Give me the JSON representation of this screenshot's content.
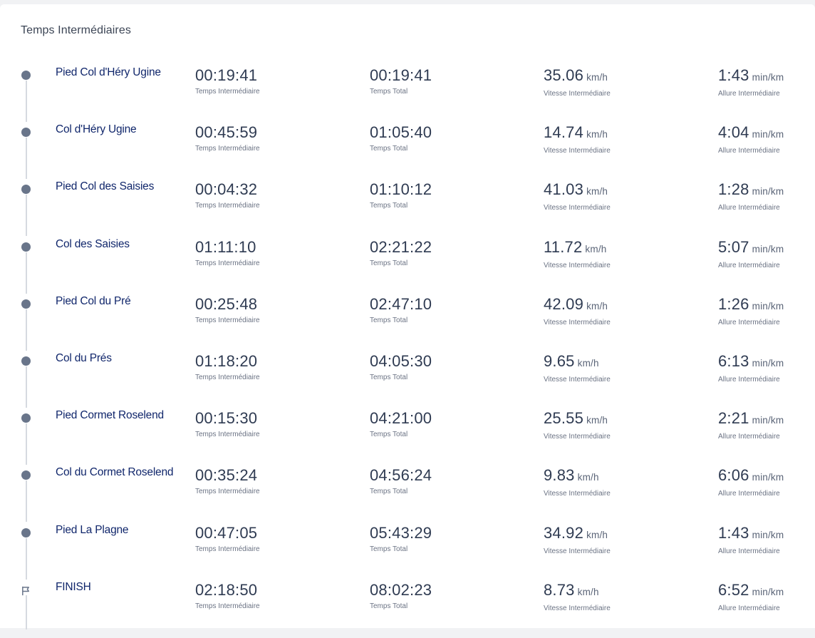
{
  "section_title": "Temps Intermédiaires",
  "labels": {
    "split_time": "Temps Intermédiaire",
    "total_time": "Temps Total",
    "split_speed": "Vitesse Intermédiaire",
    "split_pace": "Allure Intermédiaire",
    "speed_unit": "km/h",
    "pace_unit": "min/km"
  },
  "icons": {
    "checkpoint": "dot-icon",
    "finish": "flag-icon"
  },
  "colors": {
    "name": "#10266b",
    "value": "#2f3b52",
    "dot": "#69758a",
    "line": "#d6dae0"
  },
  "splits": [
    {
      "name": "Pied Col d'Héry Ugine",
      "icon": "dot",
      "split": "00:19:41",
      "total": "00:19:41",
      "speed": "35.06",
      "pace": "1:43"
    },
    {
      "name": "Col d'Héry Ugine",
      "icon": "dot",
      "split": "00:45:59",
      "total": "01:05:40",
      "speed": "14.74",
      "pace": "4:04"
    },
    {
      "name": "Pied Col des Saisies",
      "icon": "dot",
      "split": "00:04:32",
      "total": "01:10:12",
      "speed": "41.03",
      "pace": "1:28"
    },
    {
      "name": "Col des Saisies",
      "icon": "dot",
      "split": "01:11:10",
      "total": "02:21:22",
      "speed": "11.72",
      "pace": "5:07"
    },
    {
      "name": "Pied Col du Pré",
      "icon": "dot",
      "split": "00:25:48",
      "total": "02:47:10",
      "speed": "42.09",
      "pace": "1:26"
    },
    {
      "name": "Col du Prés",
      "icon": "dot",
      "split": "01:18:20",
      "total": "04:05:30",
      "speed": "9.65",
      "pace": "6:13"
    },
    {
      "name": "Pied Cormet Roselend",
      "icon": "dot",
      "split": "00:15:30",
      "total": "04:21:00",
      "speed": "25.55",
      "pace": "2:21"
    },
    {
      "name": "Col du Cormet Roselend",
      "icon": "dot",
      "split": "00:35:24",
      "total": "04:56:24",
      "speed": "9.83",
      "pace": "6:06"
    },
    {
      "name": "Pied La Plagne",
      "icon": "dot",
      "split": "00:47:05",
      "total": "05:43:29",
      "speed": "34.92",
      "pace": "1:43"
    },
    {
      "name": "FINISH",
      "icon": "flag",
      "split": "02:18:50",
      "total": "08:02:23",
      "speed": "8.73",
      "pace": "6:52"
    }
  ]
}
